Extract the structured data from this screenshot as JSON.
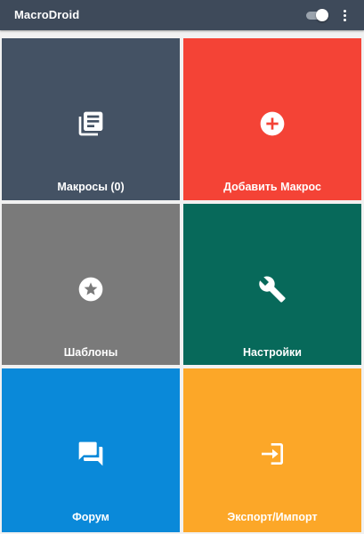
{
  "app": {
    "title": "MacroDroid",
    "toggle_icon": "toggle-on-icon",
    "menu_icon": "more-vert-icon"
  },
  "tiles": [
    {
      "label": "Макросы (0)",
      "icon": "macro-list-icon",
      "color": "#445264"
    },
    {
      "label": "Добавить Макрос",
      "icon": "add-circle-icon",
      "color": "#f44336"
    },
    {
      "label": "Шаблоны",
      "icon": "star-circle-icon",
      "color": "#7a7a7a"
    },
    {
      "label": "Настройки",
      "icon": "wrench-icon",
      "color": "#07695a"
    },
    {
      "label": "Форум",
      "icon": "forum-icon",
      "color": "#0a89d9"
    },
    {
      "label": "Экспорт/Импорт",
      "icon": "import-export-icon",
      "color": "#fca728"
    }
  ]
}
